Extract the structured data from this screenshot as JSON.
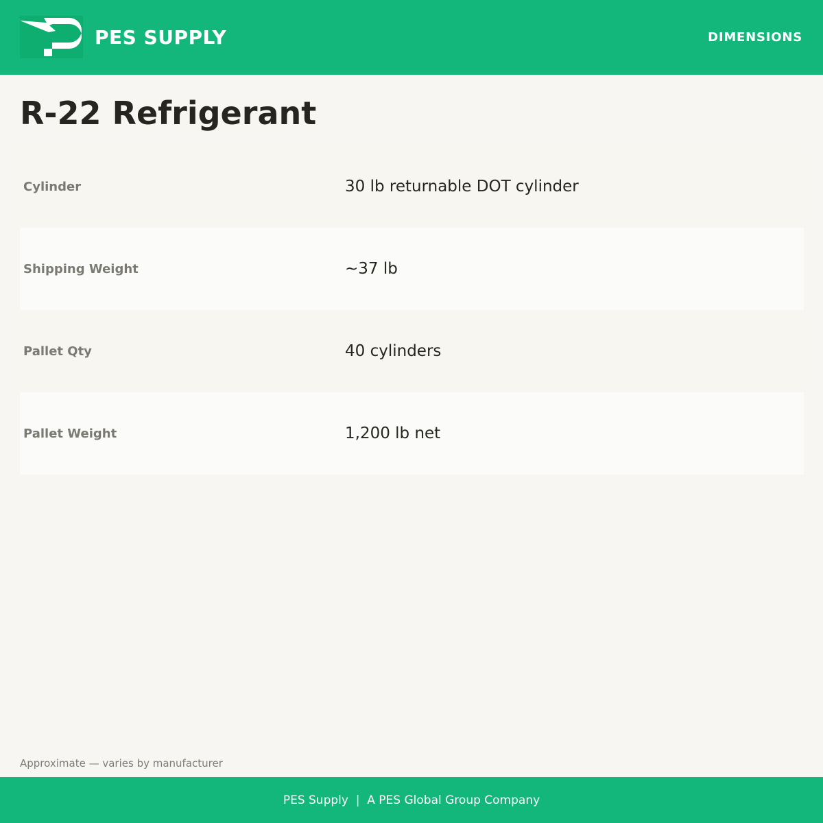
{
  "header": {
    "brand": "PES SUPPLY",
    "logo_icon": "pes-p-lightning-logo",
    "section_label": "DIMENSIONS",
    "background_color": "#13b77b"
  },
  "product": {
    "title": "R-22 Refrigerant"
  },
  "specs": [
    {
      "label": "Cylinder",
      "value": "30 lb returnable DOT cylinder"
    },
    {
      "label": "Shipping Weight",
      "value": "~37 lb"
    },
    {
      "label": "Pallet Qty",
      "value": "40 cylinders"
    },
    {
      "label": "Pallet Weight",
      "value": "1,200 lb net"
    }
  ],
  "note": "Approximate — varies by manufacturer",
  "footer": {
    "text": "PES Supply  |  A PES Global Group Company"
  }
}
